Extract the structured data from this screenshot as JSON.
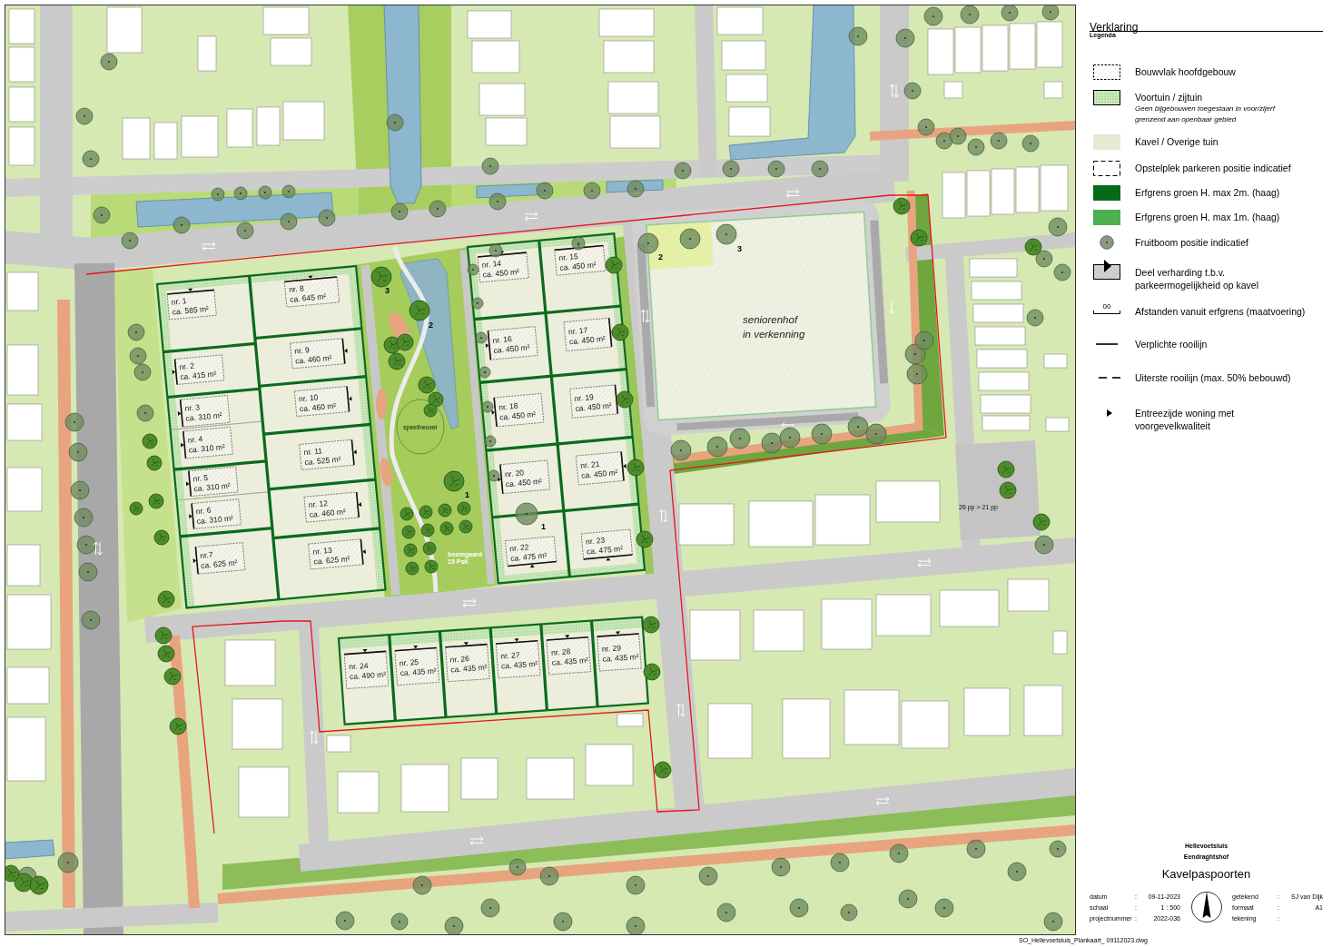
{
  "map": {
    "plot_blocks": [
      {
        "plots": [
          {
            "number": "nr. 1",
            "area": "ca. 585 m²"
          },
          {
            "number": "nr. 2",
            "area": "ca. 415 m²"
          },
          {
            "number": "nr. 3",
            "area": "ca. 310 m²"
          },
          {
            "number": "nr. 4",
            "area": "ca. 310 m²"
          },
          {
            "number": "nr. 5",
            "area": "ca. 310 m²"
          },
          {
            "number": "nr. 6",
            "area": "ca. 310 m²"
          },
          {
            "number": "nr.7",
            "area": "ca. 625 m²"
          },
          {
            "number": "nr. 8",
            "area": "ca. 645 m²"
          },
          {
            "number": "nr. 9",
            "area": "ca. 460 m²"
          },
          {
            "number": "nr. 10",
            "area": "ca. 460 m²"
          },
          {
            "number": "nr. 11",
            "area": "ca. 525 m²"
          },
          {
            "number": "nr. 12",
            "area": "ca. 460 m²"
          },
          {
            "number": "nr. 13",
            "area": "ca. 625 m²"
          }
        ]
      },
      {
        "plots": [
          {
            "number": "nr. 14",
            "area": "ca. 450 m²"
          },
          {
            "number": "nr. 15",
            "area": "ca. 450 m²"
          },
          {
            "number": "nr. 16",
            "area": "ca. 450 m²"
          },
          {
            "number": "nr. 17",
            "area": "ca. 450 m²"
          },
          {
            "number": "nr. 18",
            "area": "ca. 450 m²"
          },
          {
            "number": "nr. 19",
            "area": "ca. 450 m²"
          },
          {
            "number": "nr. 20",
            "area": "ca. 450 m²"
          },
          {
            "number": "nr. 21",
            "area": "ca. 450 m²"
          },
          {
            "number": "nr. 22",
            "area": "ca. 475 m²"
          },
          {
            "number": "nr. 23",
            "area": "ca. 475 m²"
          }
        ]
      },
      {
        "plots": [
          {
            "number": "nr. 24",
            "area": "ca. 490 m²"
          },
          {
            "number": "nr. 25",
            "area": "ca. 435 m²"
          },
          {
            "number": "nr. 26",
            "area": "ca. 435 m²"
          },
          {
            "number": "nr. 27",
            "area": "ca. 435 m²"
          },
          {
            "number": "nr. 28",
            "area": "ca. 435 m²"
          },
          {
            "number": "nr. 29",
            "area": "ca. 435 m²"
          }
        ]
      }
    ],
    "area_label": {
      "lines": [
        "seniorenhof",
        "in verkenning"
      ]
    },
    "tree_numbers": [
      "3",
      "2",
      "1",
      "1",
      "2",
      "3"
    ],
    "labels": [
      {
        "kind": "playhill",
        "lines": [
          "speelheuvel"
        ]
      },
      {
        "kind": "orchard",
        "lines": [
          "boomgaard",
          "15 PsK"
        ]
      },
      {
        "kind": "parking",
        "lines": [
          "26 pp > 21 pp"
        ]
      }
    ]
  },
  "legend": {
    "title": "Verklaring",
    "subtitle": "Legenda",
    "items": [
      {
        "kind": "hatched-box",
        "lines": [
          "Bouwvlak hoofdgebouw"
        ]
      },
      {
        "kind": "dotted-box",
        "lines": [
          "Voortuin / zijtuin"
        ],
        "note": [
          "Geen bijgebouwen toegestaan in voor/zijerf",
          "grenzend aan openbaar gebied"
        ]
      },
      {
        "kind": "fill",
        "color": "#e6ead4",
        "lines": [
          "Kavel / Overige tuin"
        ]
      },
      {
        "kind": "dashed-box",
        "lines": [
          "Opstelplek parkeren positie indicatief"
        ]
      },
      {
        "kind": "fill",
        "color": "#066a1a",
        "lines": [
          "Erfgrens groen H. max 2m. (haag)"
        ]
      },
      {
        "kind": "fill",
        "color": "#4caf50",
        "lines": [
          "Erfgrens groen H. max 1m. (haag)"
        ]
      },
      {
        "kind": "tree",
        "lines": [
          "Fruitboom positie indicatief"
        ]
      },
      {
        "kind": "paving",
        "lines": [
          "Deel verharding t.b.v.",
          "parkeermogelijkheid op kavel"
        ]
      },
      {
        "kind": "dimension",
        "symbol": "00",
        "lines": [
          "Afstanden vanuit erfgrens (maatvoering)"
        ]
      },
      {
        "kind": "solid-line",
        "lines": [
          "Verplichte rooilijn"
        ]
      },
      {
        "kind": "dashed-line",
        "lines": [
          "Uiterste rooilijn (max. 50% bebouwd)"
        ]
      },
      {
        "kind": "entrance",
        "lines": [
          "Entreezijde woning met",
          "voorgevelkwaliteit"
        ]
      }
    ]
  },
  "title_block": {
    "place": "Hellevoetsluis",
    "project": "Eendraghtshof",
    "title": "Kavelpaspoorten",
    "fields_left": [
      {
        "label": "datum",
        "separator": ":",
        "value": "09-11-2023"
      },
      {
        "label": "schaal",
        "separator": ":",
        "value": "1 : 500"
      },
      {
        "label": "projectnummer",
        "separator": ":",
        "value": "2022-036"
      }
    ],
    "fields_right": [
      {
        "label": "getekend",
        "separator": ":",
        "value": "SJ van Dijk"
      },
      {
        "label": "formaat",
        "separator": ":",
        "value": "A1"
      },
      {
        "label": "tekening",
        "separator": ":"
      }
    ]
  },
  "footer": {
    "file_name": "SO_Hellevoetsluis_Plankaart_ 09112023.dwg"
  }
}
